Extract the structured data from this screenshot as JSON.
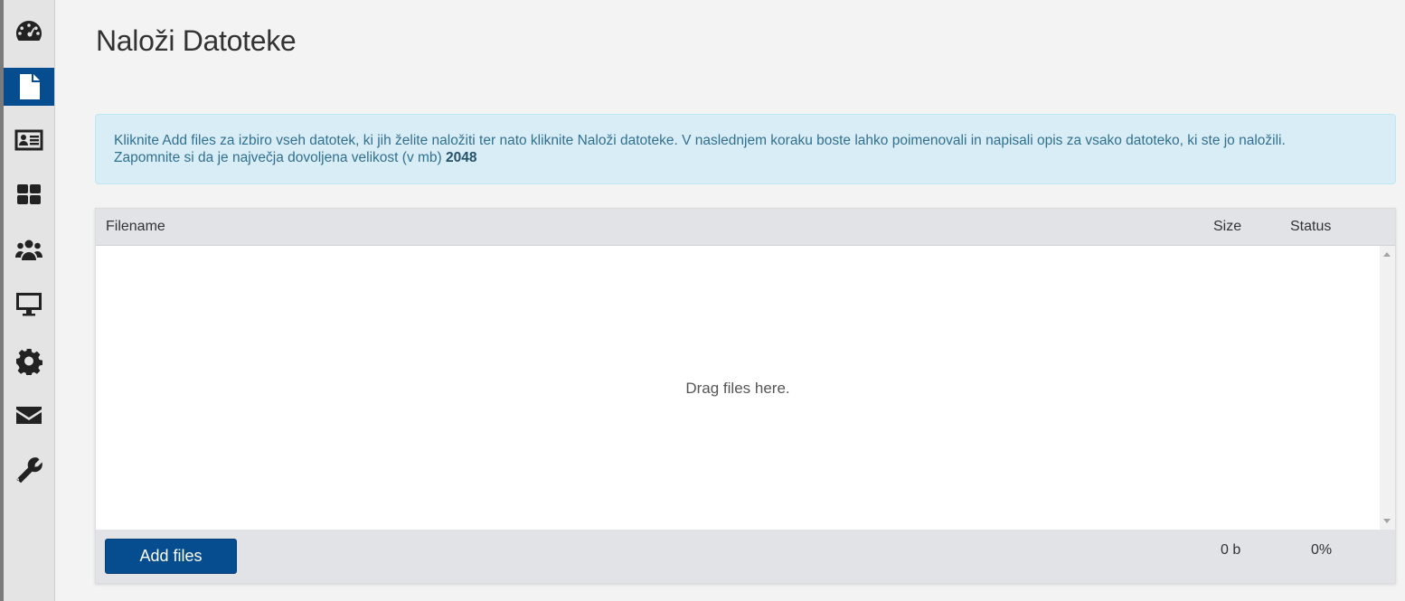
{
  "sidebar": {
    "items": [
      {
        "icon": "dashboard-icon",
        "active": false
      },
      {
        "icon": "file-icon",
        "active": true
      },
      {
        "icon": "id-card-icon",
        "active": false
      },
      {
        "icon": "grid-icon",
        "active": false
      },
      {
        "icon": "users-icon",
        "active": false
      },
      {
        "icon": "monitor-icon",
        "active": false
      },
      {
        "icon": "gear-icon",
        "active": false
      },
      {
        "icon": "envelope-icon",
        "active": false
      },
      {
        "icon": "wrench-icon",
        "active": false
      }
    ],
    "active_color": "#064d8f"
  },
  "page": {
    "title": "Naloži Datoteke"
  },
  "info": {
    "text_line1": "Kliknite Add files za izbiro vseh datotek, ki jih želite naložiti ter nato kliknite Naloži datoteke. V naslednjem koraku boste lahko poimenovali in napisali opis za vsako datoteko, ki ste jo naložili.",
    "text_line2": "Zapomnite si da je največja dovoljena velikost (v mb)",
    "max_size": "2048"
  },
  "uploader": {
    "columns": {
      "filename": "Filename",
      "size": "Size",
      "status": "Status"
    },
    "drop_text": "Drag files here.",
    "add_files_label": "Add files",
    "total_size": "0 b",
    "total_status": "0%"
  }
}
